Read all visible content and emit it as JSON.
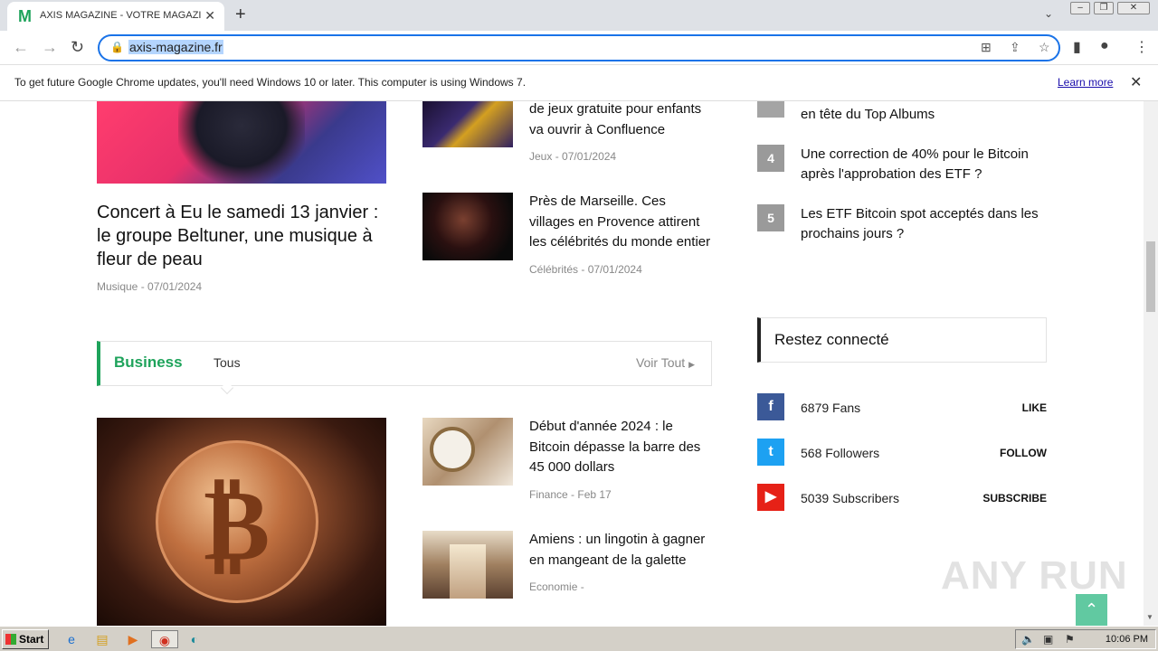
{
  "browser": {
    "tab_title": "AXIS MAGAZINE - VOTRE MAGAZINE",
    "tab_favicon": "M",
    "url": "axis-magazine.fr",
    "infobar_text": "To get future Google Chrome updates, you'll need Windows 10 or later. This computer is using Windows 7.",
    "infobar_link": "Learn more"
  },
  "left_column": {
    "big_post": {
      "title": "Concert à Eu le samedi 13 janvier : le groupe Beltuner, une musique à fleur de peau",
      "category": "Musique",
      "date": "07/01/2024"
    },
    "posts": [
      {
        "title": "de jeux gratuite pour enfants va ouvrir à Confluence",
        "category": "Jeux",
        "date": "07/01/2024"
      },
      {
        "title": "Près de Marseille. Ces villages en Provence attirent les célébrités du monde entier",
        "category": "Célébrités",
        "date": "07/01/2024"
      }
    ]
  },
  "ranking": [
    {
      "num": "",
      "text": "en tête du Top Albums"
    },
    {
      "num": "4",
      "text": "Une correction de 40% pour le Bitcoin après l'approbation des ETF ?"
    },
    {
      "num": "5",
      "text": "Les ETF Bitcoin spot acceptés dans les prochains jours ?"
    }
  ],
  "business": {
    "title": "Business",
    "tab": "Tous",
    "view_all": "Voir Tout",
    "posts": [
      {
        "title": "Début d'année 2024 : le Bitcoin dépasse la barre des 45 000 dollars",
        "category": "Finance",
        "date": "Feb 17"
      },
      {
        "title": "Amiens : un lingotin à gagner en mangeant de la galette",
        "category": "Economie",
        "date": ""
      }
    ]
  },
  "social": {
    "title": "Restez connecté",
    "items": [
      {
        "icon": "f",
        "count": "6879 Fans",
        "action": "LIKE",
        "color": "#3b5998"
      },
      {
        "icon": "t",
        "count": "568 Followers",
        "action": "FOLLOW",
        "color": "#1da1f2"
      },
      {
        "icon": "▶",
        "count": "5039 Subscribers",
        "action": "SUBSCRIBE",
        "color": "#e62117"
      }
    ]
  },
  "watermark": "ANY RUN",
  "taskbar": {
    "start": "Start",
    "clock": "10:06 PM"
  },
  "icons": {
    "back": "back-arrow-icon",
    "forward": "forward-arrow-icon",
    "reload": "reload-icon",
    "lock": "lock-icon",
    "star": "star-icon",
    "share": "share-icon",
    "profile": "profile-icon",
    "menu": "kebab-menu-icon"
  }
}
